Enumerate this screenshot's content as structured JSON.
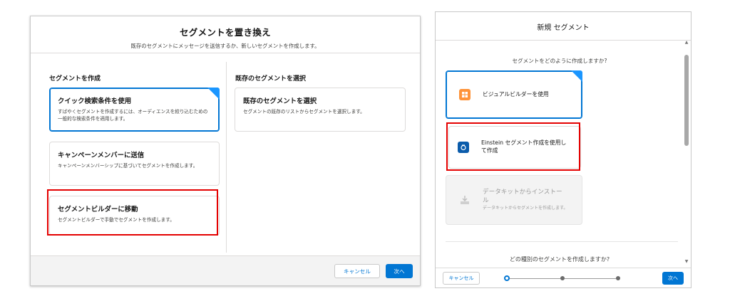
{
  "left_modal": {
    "title": "セグメントを置き換え",
    "subtitle": "既存のセグメントにメッセージを送信するか、新しいセグメントを作成します。",
    "create_heading": "セグメントを作成",
    "existing_heading": "既存のセグメントを選択",
    "cards": [
      {
        "title": "クイック検索条件を使用",
        "desc": "すばやくセグメントを作成するには、オーディエンスを絞り込むための一般的な検索条件を適用します。"
      },
      {
        "title": "キャンペーンメンバーに送信",
        "desc": "キャンペーンメンバーシップに基づいてセグメントを作成します。"
      },
      {
        "title": "セグメントビルダーに移動",
        "desc": "セグメントビルダーで手動でセグメントを作成します。"
      }
    ],
    "existing_card": {
      "title": "既存のセグメントを選択",
      "desc": "セグメントの既存のリストからセグメントを選択します。"
    },
    "cancel": "キャンセル",
    "next": "次へ"
  },
  "right_modal": {
    "title": "新規 セグメント",
    "question1": "セグメントをどのように作成しますか?",
    "question2": "どの種別のセグメントを作成しますか?",
    "options": [
      {
        "label": "ビジュアルビルダーを使用",
        "icon": "builder-icon",
        "color": "#fe9339"
      },
      {
        "label": "Einstein セグメント作成を使用して作成",
        "icon": "einstein-icon",
        "color": "#0b5cab"
      },
      {
        "label": "データキットからインストール",
        "sub": "データキットからセグメントを作成します。",
        "icon": "install-icon"
      }
    ],
    "cancel": "キャンセル",
    "next": "次へ"
  },
  "colors": {
    "brand": "#0176d3",
    "highlight": "#e40000",
    "corner": "#1b96ff"
  }
}
